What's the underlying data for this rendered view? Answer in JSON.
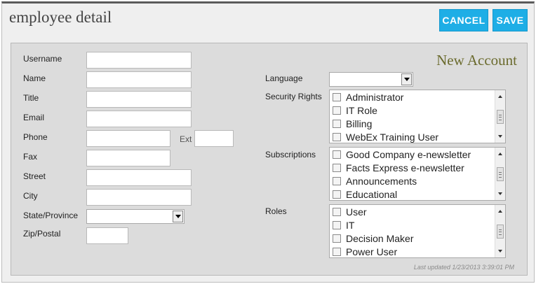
{
  "header": {
    "title": "employee detail",
    "cancel_label": "CANCEL",
    "save_label": "SAVE"
  },
  "form": {
    "subtitle": "New Account",
    "fields": {
      "username": {
        "label": "Username",
        "value": ""
      },
      "name": {
        "label": "Name",
        "value": ""
      },
      "title": {
        "label": "Title",
        "value": ""
      },
      "email": {
        "label": "Email",
        "value": ""
      },
      "phone": {
        "label": "Phone",
        "value": ""
      },
      "ext": {
        "label": "Ext",
        "value": ""
      },
      "fax": {
        "label": "Fax",
        "value": ""
      },
      "street": {
        "label": "Street",
        "value": ""
      },
      "city": {
        "label": "City",
        "value": ""
      },
      "state": {
        "label": "State/Province",
        "value": ""
      },
      "zip": {
        "label": "Zip/Postal",
        "value": ""
      },
      "language": {
        "label": "Language",
        "value": ""
      }
    },
    "security_rights": {
      "label": "Security Rights",
      "items": [
        "Administrator",
        "IT Role",
        "Billing",
        "WebEx Training User"
      ]
    },
    "subscriptions": {
      "label": "Subscriptions",
      "items": [
        "Good Company e-newsletter",
        "Facts Express e-newsletter",
        "Announcements",
        "Educational"
      ]
    },
    "roles": {
      "label": "Roles",
      "items": [
        "User",
        "IT",
        "Decision Maker",
        "Power User"
      ]
    },
    "last_updated": "Last updated 1/23/2013 3:39:01 PM"
  },
  "colors": {
    "button_bg": "#1eaee6",
    "subtitle": "#6b6b2e",
    "panel_bg": "#dcdcdc"
  }
}
